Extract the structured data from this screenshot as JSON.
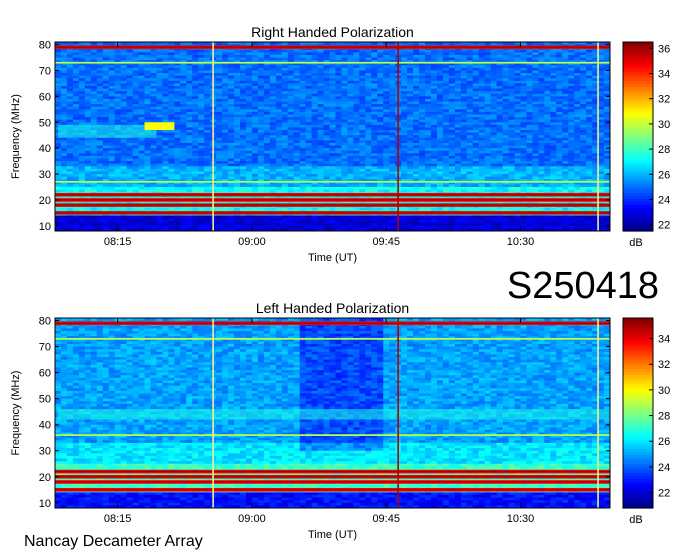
{
  "observation_id": "S250418",
  "instrument": "Nancay Decameter Array",
  "chart_data": [
    {
      "type": "heatmap",
      "title": "Right Handed Polarization",
      "xlabel": "Time (UT)",
      "ylabel": "Frequency (MHz)",
      "xlim": [
        "07:54",
        "11:00"
      ],
      "ylim": [
        8,
        81
      ],
      "x_ticks": [
        "08:15",
        "09:00",
        "09:45",
        "10:30"
      ],
      "y_ticks": [
        10,
        20,
        30,
        40,
        50,
        60,
        70,
        80
      ],
      "colorbar": {
        "label": "dB",
        "range": [
          21.5,
          36.5
        ],
        "ticks": [
          22,
          24,
          26,
          28,
          30,
          32,
          34,
          36
        ]
      },
      "features": {
        "interference_bands_mhz": [
          15,
          18,
          20,
          22,
          27,
          73,
          79
        ],
        "vertical_lines_ut": [
          "08:47",
          "09:49",
          "10:56"
        ],
        "burst": {
          "time_ut": [
            "08:24",
            "08:34"
          ],
          "freq_mhz": [
            47,
            50
          ]
        },
        "diffuse_emission": {
          "time_ut": [
            "07:55",
            "08:28"
          ],
          "freq_mhz": [
            44,
            49
          ]
        }
      }
    },
    {
      "type": "heatmap",
      "title": "Left Handed Polarization",
      "xlabel": "Time (UT)",
      "ylabel": "Frequency (MHz)",
      "xlim": [
        "07:54",
        "11:00"
      ],
      "ylim": [
        8,
        81
      ],
      "x_ticks": [
        "08:15",
        "09:00",
        "09:45",
        "10:30"
      ],
      "y_ticks": [
        10,
        20,
        30,
        40,
        50,
        60,
        70,
        80
      ],
      "colorbar": {
        "label": "dB",
        "range": [
          20.8,
          35.6
        ],
        "ticks": [
          22,
          24,
          26,
          28,
          30,
          32,
          34
        ]
      },
      "features": {
        "interference_bands_mhz": [
          15,
          18,
          20,
          22,
          36,
          73,
          79
        ],
        "vertical_lines_ut": [
          "08:47",
          "09:49",
          "10:56"
        ],
        "diffuse_emission": {
          "time_ut": [
            "07:55",
            "11:00"
          ],
          "freq_mhz": [
            42,
            46
          ]
        }
      }
    }
  ]
}
